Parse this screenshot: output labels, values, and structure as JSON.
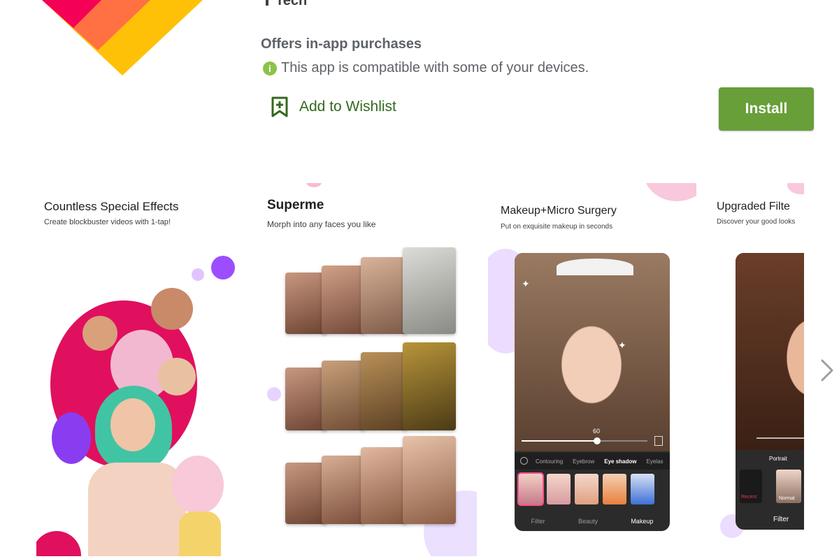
{
  "header": {
    "top_partial": "Tech",
    "offers_text": "Offers in-app purchases",
    "compat_text": "This app is compatible with some of your devices.",
    "info_icon_glyph": "i",
    "wishlist_label": "Add to Wishlist",
    "install_label": "Install"
  },
  "screenshots": [
    {
      "title": "Countless Special Effects",
      "subtitle": "Create blockbuster videos with 1-tap!"
    },
    {
      "title": "Superme",
      "subtitle": "Morph into any faces you like"
    },
    {
      "title": "Makeup+Micro Surgery",
      "subtitle": "Put on exquisite makeup in seconds"
    },
    {
      "title": "Upgraded Filte",
      "subtitle": "Discover your good looks"
    }
  ],
  "makeup_phone": {
    "slider_value": "60",
    "slider_level": 0.6,
    "categories": [
      "Contouring",
      "Eyebrow",
      "Eye shadow",
      "Eyelas"
    ],
    "bottom_tabs": [
      "Filter",
      "Beauty",
      "Makeup"
    ]
  },
  "filter_phone": {
    "tabs": [
      "Portrait"
    ],
    "items": [
      "Recent",
      "Normal"
    ],
    "bottom_tab": "Filter"
  },
  "icons": {
    "wishlist": "bookmark-plus-icon",
    "next": "chevron-right-icon",
    "info": "info-icon"
  },
  "colors": {
    "accent": "#689f38",
    "wishlist_text": "#33691e",
    "info": "#8bc34a"
  }
}
